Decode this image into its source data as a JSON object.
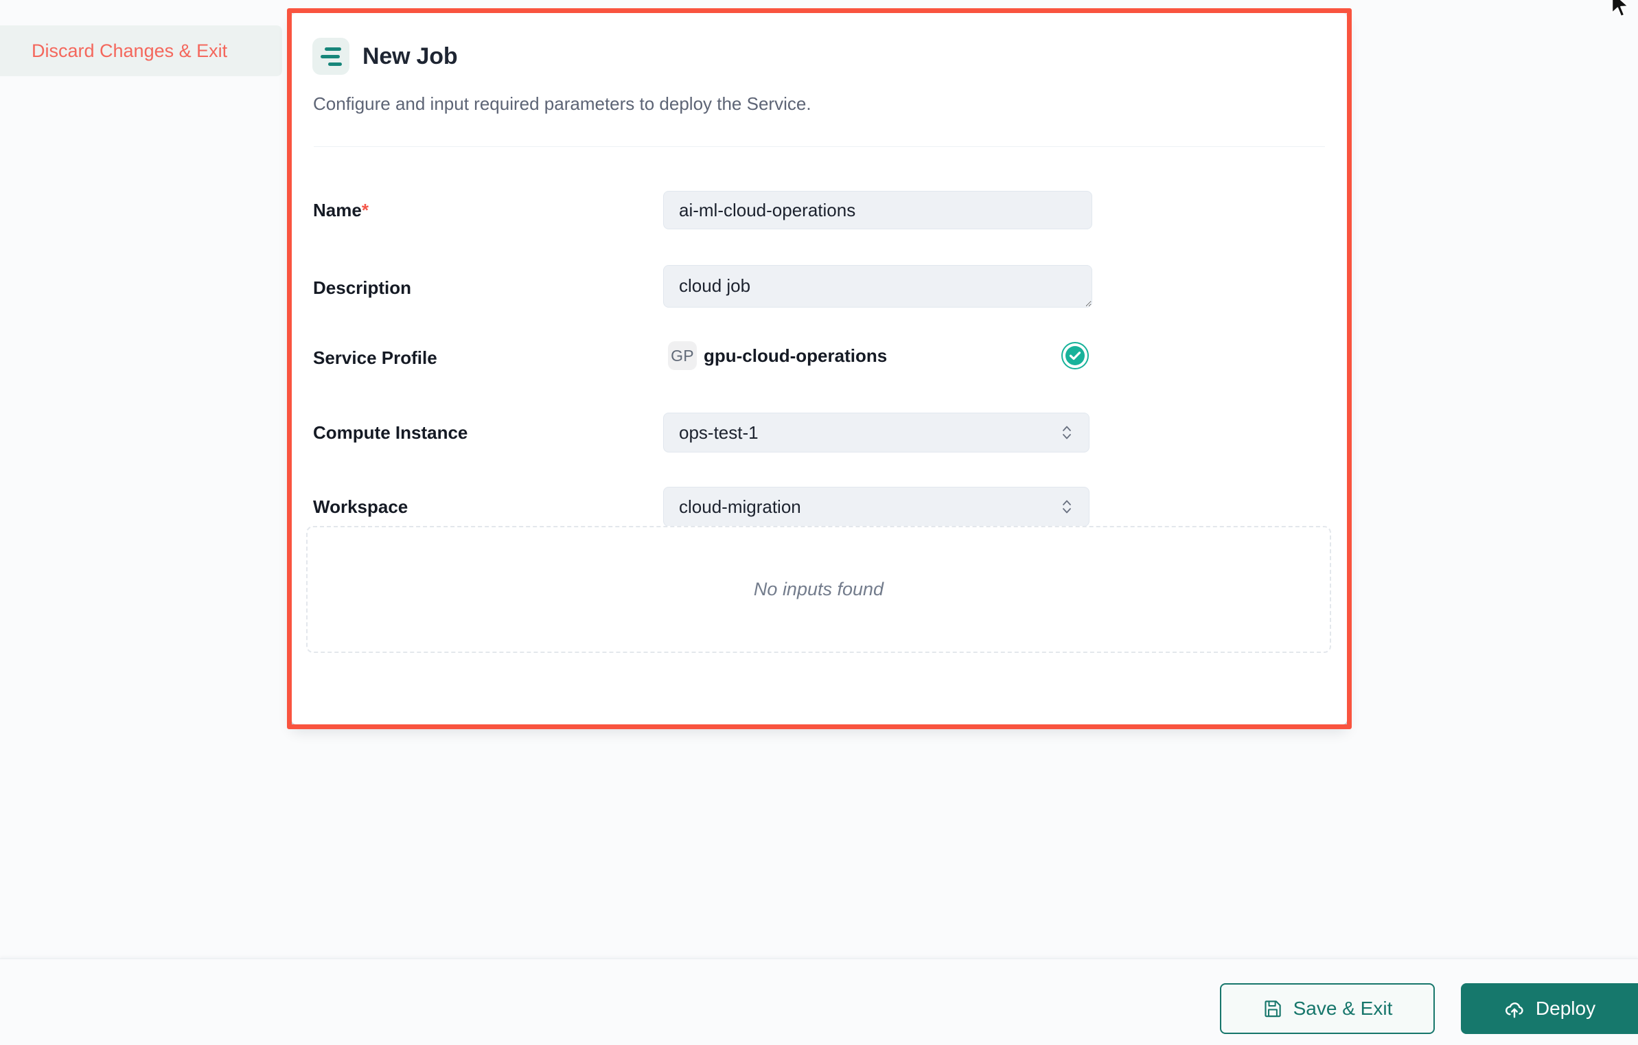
{
  "window": {
    "background_color": "#fafbfc"
  },
  "card": {
    "highlight_color": "#f9543f",
    "header": {
      "icon": "align-left-icon",
      "title": "New Job",
      "subtitle": "Configure and input required parameters to deploy the Service."
    },
    "fields": [
      {
        "name": "name",
        "label": "Name",
        "required_marker": "*",
        "type": "text",
        "value": "ai-ml-cloud-operations",
        "placeholder": "Name"
      },
      {
        "name": "description",
        "label": "Description",
        "type": "textarea",
        "value": "cloud job",
        "placeholder": "Description"
      },
      {
        "name": "service-profile",
        "label": "Service Profile",
        "type": "profile",
        "avatar_initials": "GP",
        "value": "gpu-cloud-operations",
        "status": "valid",
        "status_icon": "check-circle-icon",
        "status_color": "#17b29a"
      },
      {
        "name": "compute-instance",
        "label": "Compute Instance",
        "type": "select",
        "value": "ops-test-1"
      },
      {
        "name": "workspace",
        "label": "Workspace",
        "type": "select",
        "value": "cloud-migration"
      }
    ],
    "inputs_panel": {
      "empty_text": "No inputs found"
    }
  },
  "footer": {
    "discard_label": "Discard Changes & Exit",
    "discard_color": "#f4675c",
    "save_label": "Save & Exit",
    "save_icon": "save-disk-icon",
    "deploy_label": "Deploy",
    "deploy_icon": "cloud-upload-icon",
    "accent_color": "#16786c"
  }
}
